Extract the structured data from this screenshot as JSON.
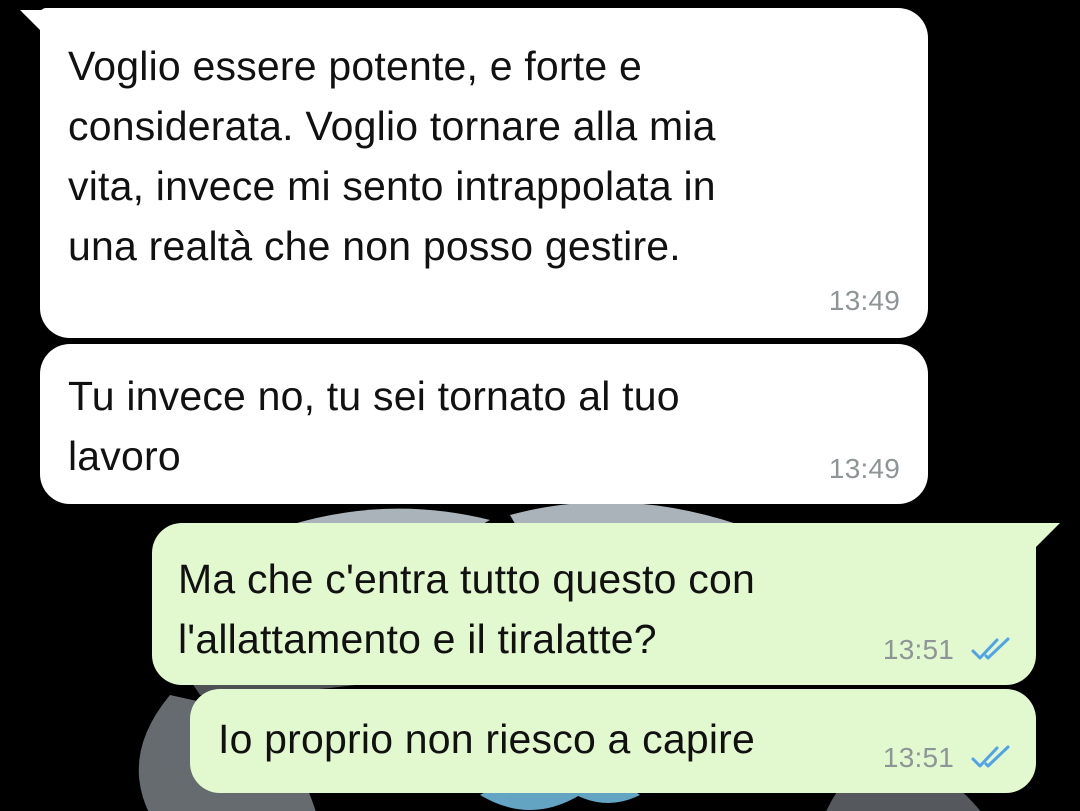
{
  "colors": {
    "background": "#000000",
    "incoming_bubble": "#ffffff",
    "outgoing_bubble": "#e2f8cf",
    "timestamp": "#8e9596",
    "read_ticks": "#4fa3e6"
  },
  "messages": [
    {
      "direction": "incoming",
      "text": "Voglio essere potente, e forte e\nconsiderata. Voglio tornare alla mia\nvita, invece mi sento intrappolata in\nuna realtà che non posso gestire.",
      "time": "13:49"
    },
    {
      "direction": "incoming",
      "text": "Tu invece no, tu sei tornato al tuo\nlavoro",
      "time": "13:49"
    },
    {
      "direction": "outgoing",
      "text": "Ma che c'entra tutto questo con\nl'allattamento e il tiralatte?",
      "time": "13:51",
      "status_icon": "double-check-read-icon"
    },
    {
      "direction": "outgoing",
      "text": "Io proprio non riesco a capire",
      "time": "13:51",
      "status_icon": "double-check-read-icon"
    }
  ]
}
